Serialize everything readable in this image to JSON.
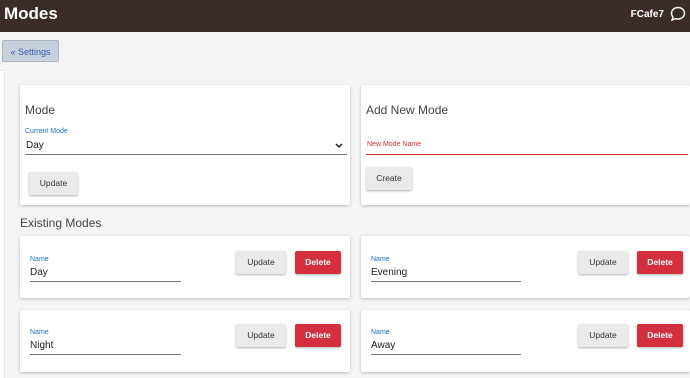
{
  "header": {
    "title": "Modes",
    "hub_name": "FCafe7",
    "chat_icon": "chat-bubble-icon"
  },
  "subbar": {
    "settings_label": "« Settings"
  },
  "mode_card": {
    "title": "Mode",
    "current_label": "Current Mode",
    "current_value": "Day",
    "update_label": "Update"
  },
  "add_card": {
    "title": "Add New Mode",
    "name_label": "New Mode Name",
    "name_value": "",
    "create_label": "Create"
  },
  "existing": {
    "title": "Existing Modes",
    "modes": [
      {
        "name_label": "Name",
        "name": "Day",
        "update": "Update",
        "delete": "Delete"
      },
      {
        "name_label": "Name",
        "name": "Evening",
        "update": "Update",
        "delete": "Delete"
      },
      {
        "name_label": "Name",
        "name": "Night",
        "update": "Update",
        "delete": "Delete"
      },
      {
        "name_label": "Name",
        "name": "Away",
        "update": "Update",
        "delete": "Delete"
      }
    ]
  },
  "colors": {
    "header_bg": "#3b2c29",
    "delete_red": "#d32f3c",
    "accent_blue": "#1a73c8"
  }
}
